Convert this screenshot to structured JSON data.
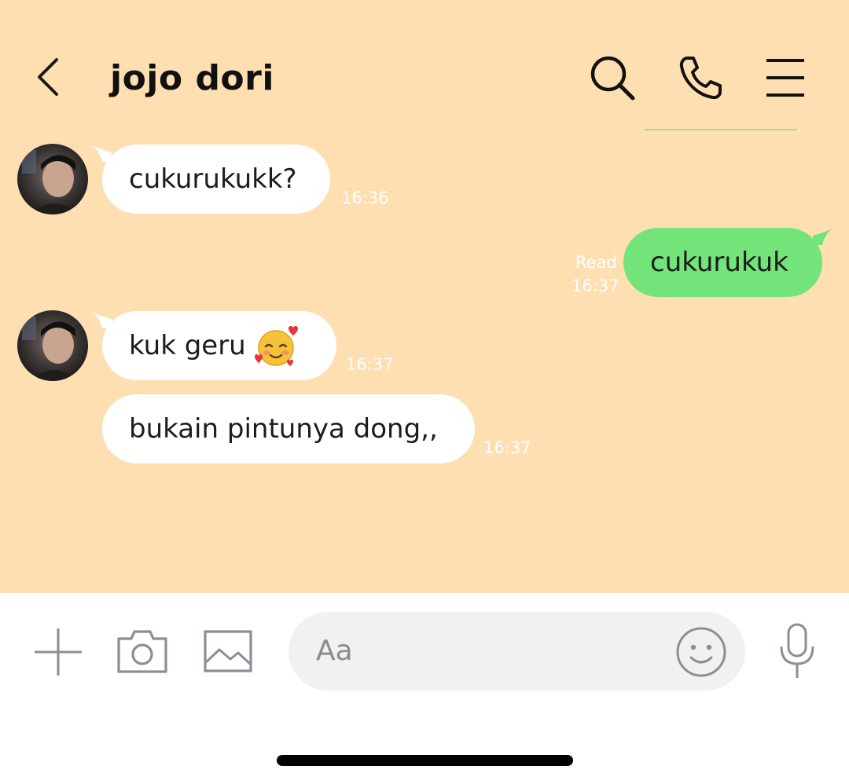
{
  "header": {
    "back_icon": "chevron-left-icon",
    "title": "jojo dori",
    "actions": [
      "search-icon",
      "phone-icon",
      "menu-icon"
    ]
  },
  "messages": [
    {
      "direction": "incoming",
      "text": "cukurukukk?",
      "time": "16:36",
      "show_avatar": true
    },
    {
      "direction": "outgoing",
      "text": "cukurukuk",
      "time": "16:37",
      "status": "Read"
    },
    {
      "direction": "incoming",
      "text": "kuk geru",
      "emoji": "smiling-face-with-hearts",
      "time": "16:37",
      "show_avatar": true
    },
    {
      "direction": "incoming",
      "text": "bukain pintunya dong,,",
      "time": "16:37",
      "show_avatar": false
    }
  ],
  "composer": {
    "placeholder": "Aa",
    "icons": [
      "plus-icon",
      "camera-icon",
      "image-icon",
      "smiley-icon",
      "microphone-icon"
    ]
  },
  "colors": {
    "chat_background": "#fedfb2",
    "incoming_bubble": "#ffffff",
    "outgoing_bubble": "#72e479",
    "input_background": "#f1f1f1",
    "icon_gray": "#8a8f96"
  }
}
